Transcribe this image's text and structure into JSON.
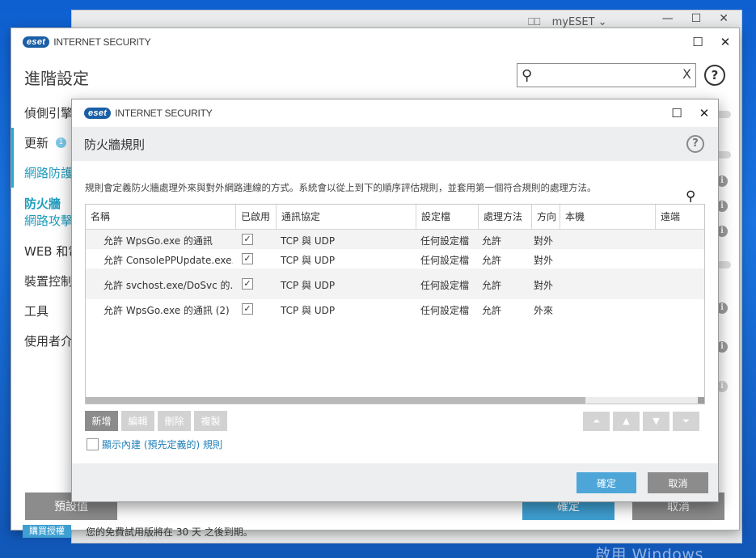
{
  "desktop": {
    "activate_text": "啟用 Windows"
  },
  "behind": {
    "title": "myESET",
    "min": "—",
    "max": "☐",
    "close": "✕"
  },
  "main": {
    "logo_badge": "eset",
    "logo_text": "INTERNET SECURITY",
    "title": "進階設定",
    "search": {
      "value": "",
      "placeholder": "",
      "clear": "X"
    },
    "help": "?",
    "nav": {
      "detection": "偵側引擎",
      "update": "更新",
      "update_badge": "1",
      "network": "網路防護",
      "firewall": "防火牆",
      "network_attack": "網路攻擊",
      "web": "WEB 和電",
      "device": "裝置控制",
      "tools": "工具",
      "ui": "使用者介"
    },
    "info_icon": "i",
    "default_label": "預設值",
    "ok_label": "確定",
    "cancel_label": "取消",
    "license_label": "購買授權",
    "license_text": "您的免費試用版將在 30 天 之後到期。"
  },
  "dialog": {
    "logo_badge": "eset",
    "logo_text": "INTERNET SECURITY",
    "max": "☐",
    "close": "✕",
    "title": "防火牆規則",
    "help": "?",
    "description": "規則會定義防火牆處理外來與對外網路連線的方式。系統會以從上到下的順序評估規則，並套用第一個符合規則的處理方法。",
    "columns": [
      "名稱",
      "已啟用",
      "通訊協定",
      "設定檔",
      "處理方法",
      "方向",
      "本機",
      "遠端"
    ],
    "rows": [
      {
        "name": "允許 WpsGo.exe 的通訊",
        "check": "✓",
        "protocol": "TCP 與 UDP",
        "profile": "任何設定檔",
        "action": "允許",
        "direction": "對外"
      },
      {
        "name": "允許 ConsolePPUpdate.exe...",
        "check": "✓",
        "protocol": "TCP 與 UDP",
        "profile": "任何設定檔",
        "action": "允許",
        "direction": "對外"
      },
      {
        "name": "允許 svchost.exe/DoSvc 的...",
        "check": "✓",
        "protocol": "TCP 與 UDP",
        "profile": "任何設定檔",
        "action": "允許",
        "direction": "對外"
      },
      {
        "name": "允許 WpsGo.exe 的通訊 (2)",
        "check": "✓",
        "protocol": "TCP 與 UDP",
        "profile": "任何設定檔",
        "action": "允許",
        "direction": "外來"
      }
    ],
    "buttons": {
      "add": "新增",
      "edit": "編輯",
      "delete": "刪除",
      "copy": "複製"
    },
    "arrows": {
      "top": "⏶",
      "up": "▲",
      "down": "▼",
      "bottom": "⏷"
    },
    "show_builtin": "顯示內建 (預先定義的) 規則",
    "ok": "確定",
    "cancel": "取消"
  }
}
